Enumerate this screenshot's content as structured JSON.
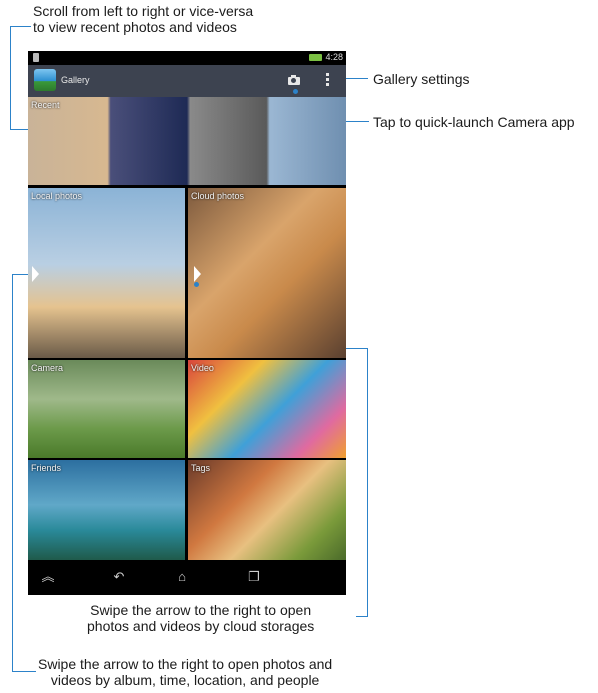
{
  "callouts": {
    "scroll": "Scroll from left to right or vice-versa to view recent photos and videos",
    "scroll_line1": "Scroll from left to right or vice-versa",
    "scroll_line2": "to view recent photos and videos",
    "gallery_settings": "Gallery settings",
    "camera": "Tap to quick-launch Camera app",
    "cloud_line1": "Swipe the arrow to the right to open",
    "cloud_line2": "photos and videos by cloud storages",
    "local_line1": "Swipe the arrow to the right to open photos and",
    "local_line2": "videos by album, time, location, and people"
  },
  "status_bar": {
    "time": "4:28"
  },
  "app_bar": {
    "title": "Gallery"
  },
  "tiles": {
    "recent": "Recent",
    "local": "Local photos",
    "cloud": "Cloud photos",
    "camera": "Camera",
    "video": "Video",
    "friends": "Friends",
    "tags": "Tags"
  },
  "navbar": {
    "hide": "︽",
    "back": "↶",
    "home": "⌂",
    "recent": "❐"
  },
  "colors": {
    "accent": "#2c82c9",
    "app_bar": "#3d4350",
    "battery": "#7bc043"
  }
}
